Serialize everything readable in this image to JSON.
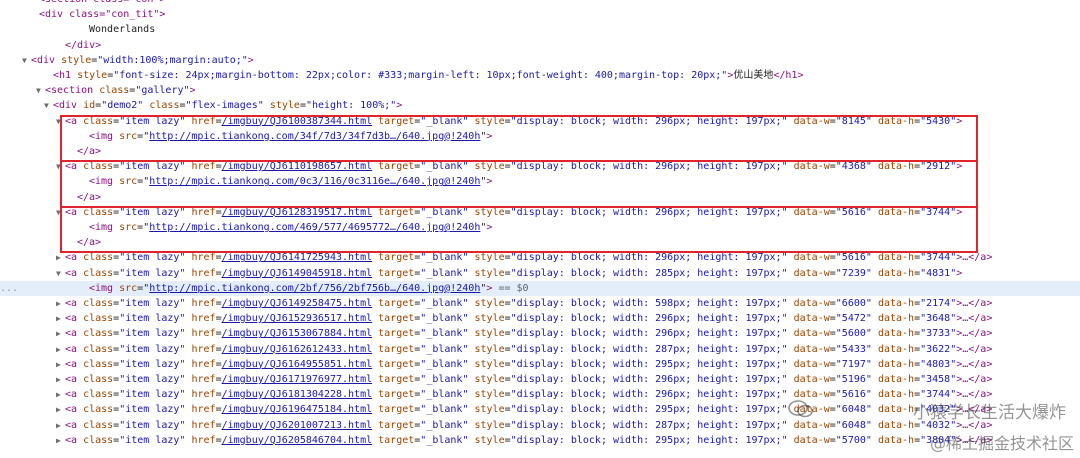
{
  "tree": {
    "cut_top": "<section class=\"con\">",
    "con_tit_open": "<div class=\"con_tit\">",
    "con_tit_text": "Wonderlands",
    "div_close": "</div>",
    "outer_div": {
      "pre": "<div ",
      "an": "style",
      "av": "\"width:100%;margin:auto;\"",
      "post": ">"
    },
    "h1": {
      "pre": "<h1 ",
      "an": "style",
      "av": "\"font-size: 24px;margin-bottom: 22px;color: #333;margin-left: 10px;font-weight: 400;margin-top: 20px;\"",
      "mid": ">",
      "text": "优山美地",
      "post": "</h1>"
    },
    "section": {
      "pre": "<section ",
      "an": "class",
      "av": "\"gallery\"",
      "post": ">"
    },
    "demo2": {
      "pre": "<div ",
      "an1": "id",
      "av1": "\"demo2\"",
      "an2": "class",
      "av2": "\"flex-images\"",
      "an3": "style",
      "av3": "\"height: 100%;\"",
      "post": ">"
    },
    "a_close": "</a>",
    "expanded": [
      {
        "href": "/imgbuy/QJ6100387344.html",
        "style": "\"display: block; width: 296px; height: 197px;\"",
        "w": "\"8145\"",
        "h": "\"5430\"",
        "img": "http://mpic.tiankong.com/34f/7d3/34f7d3b…/640.jpg@!240h"
      },
      {
        "href": "/imgbuy/QJ6110198657.html",
        "style": "\"display: block; width: 296px; height: 197px;\"",
        "w": "\"4368\"",
        "h": "\"2912\"",
        "img": "http://mpic.tiankong.com/0c3/116/0c3116e…/640.jpg@!240h"
      },
      {
        "href": "/imgbuy/QJ6128319517.html",
        "style": "\"display: block; width: 296px; height: 197px;\"",
        "w": "\"5616\"",
        "h": "\"3744\"",
        "img": "http://mpic.tiankong.com/469/577/4695772…/640.jpg@!240h"
      }
    ],
    "collapsed_a": {
      "href": "/imgbuy/QJ6141725943.html",
      "style": "\"display: block; width: 296px; height: 197px;\"",
      "w": "\"5616\"",
      "h": "\"3744\""
    },
    "open_a": {
      "href": "/imgbuy/QJ6149045918.html",
      "style": "\"display: block; width: 285px; height: 197px;\"",
      "w": "\"7239\"",
      "h": "\"4831\""
    },
    "selected_img": {
      "src": "http://mpic.tiankong.com/2bf/756/2bf756b…/640.jpg@!240h",
      "suffix": "== $0",
      "gutter": "..."
    },
    "rows": [
      {
        "href": "/imgbuy/QJ6149258475.html",
        "style": "\"display: block; width: 598px; height: 197px;\"",
        "w": "\"6600\"",
        "h": "\"2174\""
      },
      {
        "href": "/imgbuy/QJ6152936517.html",
        "style": "\"display: block; width: 296px; height: 197px;\"",
        "w": "\"5472\"",
        "h": "\"3648\""
      },
      {
        "href": "/imgbuy/QJ6153067884.html",
        "style": "\"display: block; width: 296px; height: 197px;\"",
        "w": "\"5600\"",
        "h": "\"3733\""
      },
      {
        "href": "/imgbuy/QJ6162612433.html",
        "style": "\"display: block; width: 287px; height: 197px;\"",
        "w": "\"5433\"",
        "h": "\"3622\""
      },
      {
        "href": "/imgbuy/QJ6164955851.html",
        "style": "\"display: block; width: 295px; height: 197px;\"",
        "w": "\"7197\"",
        "h": "\"4803\""
      },
      {
        "href": "/imgbuy/QJ6171976977.html",
        "style": "\"display: block; width: 296px; height: 197px;\"",
        "w": "\"5196\"",
        "h": "\"3458\""
      },
      {
        "href": "/imgbuy/QJ6181304228.html",
        "style": "\"display: block; width: 296px; height: 197px;\"",
        "w": "\"5616\"",
        "h": "\"3744\""
      },
      {
        "href": "/imgbuy/QJ6196475184.html",
        "style": "\"display: block; width: 295px; height: 197px;\"",
        "w": "\"6048\"",
        "h": "\"4032\""
      },
      {
        "href": "/imgbuy/QJ6201007213.html",
        "style": "\"display: block; width: 287px; height: 197px;\"",
        "w": "\"6048\"",
        "h": "\"4032\""
      },
      {
        "href": "/imgbuy/QJ6205846704.html",
        "style": "\"display: block; width: 295px; height: 197px;\"",
        "w": "\"5700\"",
        "h": "\"3804\""
      }
    ],
    "a_pre": "<a ",
    "an_class": "class",
    "av_class": "\"item lazy\"",
    "an_href": "href",
    "an_target": "target",
    "av_target": "\"_blank\"",
    "an_style": "style",
    "an_dw": "data-w",
    "an_dh": "data-h",
    "gt": ">",
    "ellipsis_close": "…</a>",
    "img_pre": "<img ",
    "an_src": "src"
  },
  "watermark": {
    "line1": "小猿学长生活大爆炸",
    "line2": "@稀土掘金技术社区"
  },
  "colors": {
    "highlight_box": "#e0242c",
    "selected_row": "#e4eefb",
    "tag": "#881280",
    "attr_name": "#994500",
    "attr_value": "#1a1aa6"
  }
}
